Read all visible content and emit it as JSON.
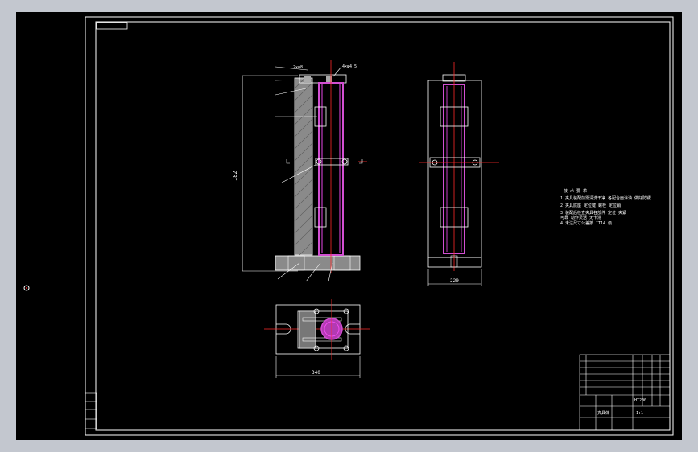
{
  "colors": {
    "background": "#000000",
    "frame": "#c3c7cf",
    "lines": "#ffffff",
    "hatch": "#9a9a9a",
    "part": "#c23cc2",
    "part_fill": "#d24fd2",
    "centerline": "#ff2a2a"
  },
  "dimensions": {
    "height": "182",
    "width_side": "220",
    "width_top": "340"
  },
  "leaders": {
    "top_left": "2×φ8",
    "top_right": "4×φ4.5"
  },
  "notes": {
    "lines": [
      "技 术 要 求",
      "1  夹具装配前需清洗干净 各配合面涂油 做好防锈",
      "2  夹具底座 定位键 螺栓 定位销",
      "3  装配后检查夹具各部件 定位 夹紧",
      "   可靠 动作灵活 无卡滞",
      "4  未注尺寸公差按 IT14 级"
    ]
  },
  "title_block": {
    "label_main": "夹具体",
    "label_scale": "1:1",
    "label_material": "HT200"
  },
  "icons": {
    "ucs_marker": "crosshair-icon"
  }
}
